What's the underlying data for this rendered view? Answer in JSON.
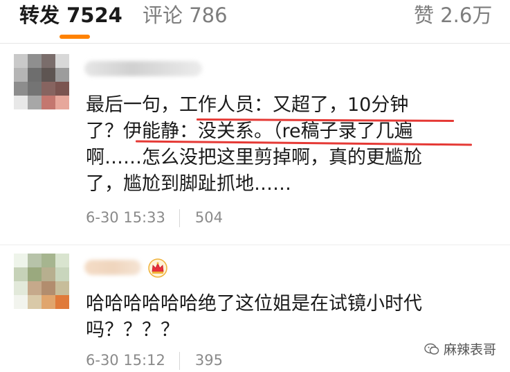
{
  "tabs": {
    "repost": "转发 7524",
    "comment": "评论 786",
    "like": "赞 2.6万"
  },
  "comments": [
    {
      "lines": [
        "最后一句，工作人员：又超了，10分钟",
        "了？伊能静：没关系。（re稿子录了几遍",
        "啊……怎么没把这里剪掉啊，真的更尴尬",
        "了，尴尬到脚趾抓地……"
      ],
      "time": "6-30 15:33",
      "likes": "504"
    },
    {
      "lines": [
        "哈哈哈哈哈哈绝了这位姐是在试镜小时代",
        "吗？？？？"
      ],
      "time": "6-30 15:12",
      "likes": "395",
      "badge_icon": "crown-icon"
    }
  ],
  "watermark": "麻辣表哥",
  "colors": {
    "accent": "#ff8200",
    "highlight": "#e53935"
  }
}
